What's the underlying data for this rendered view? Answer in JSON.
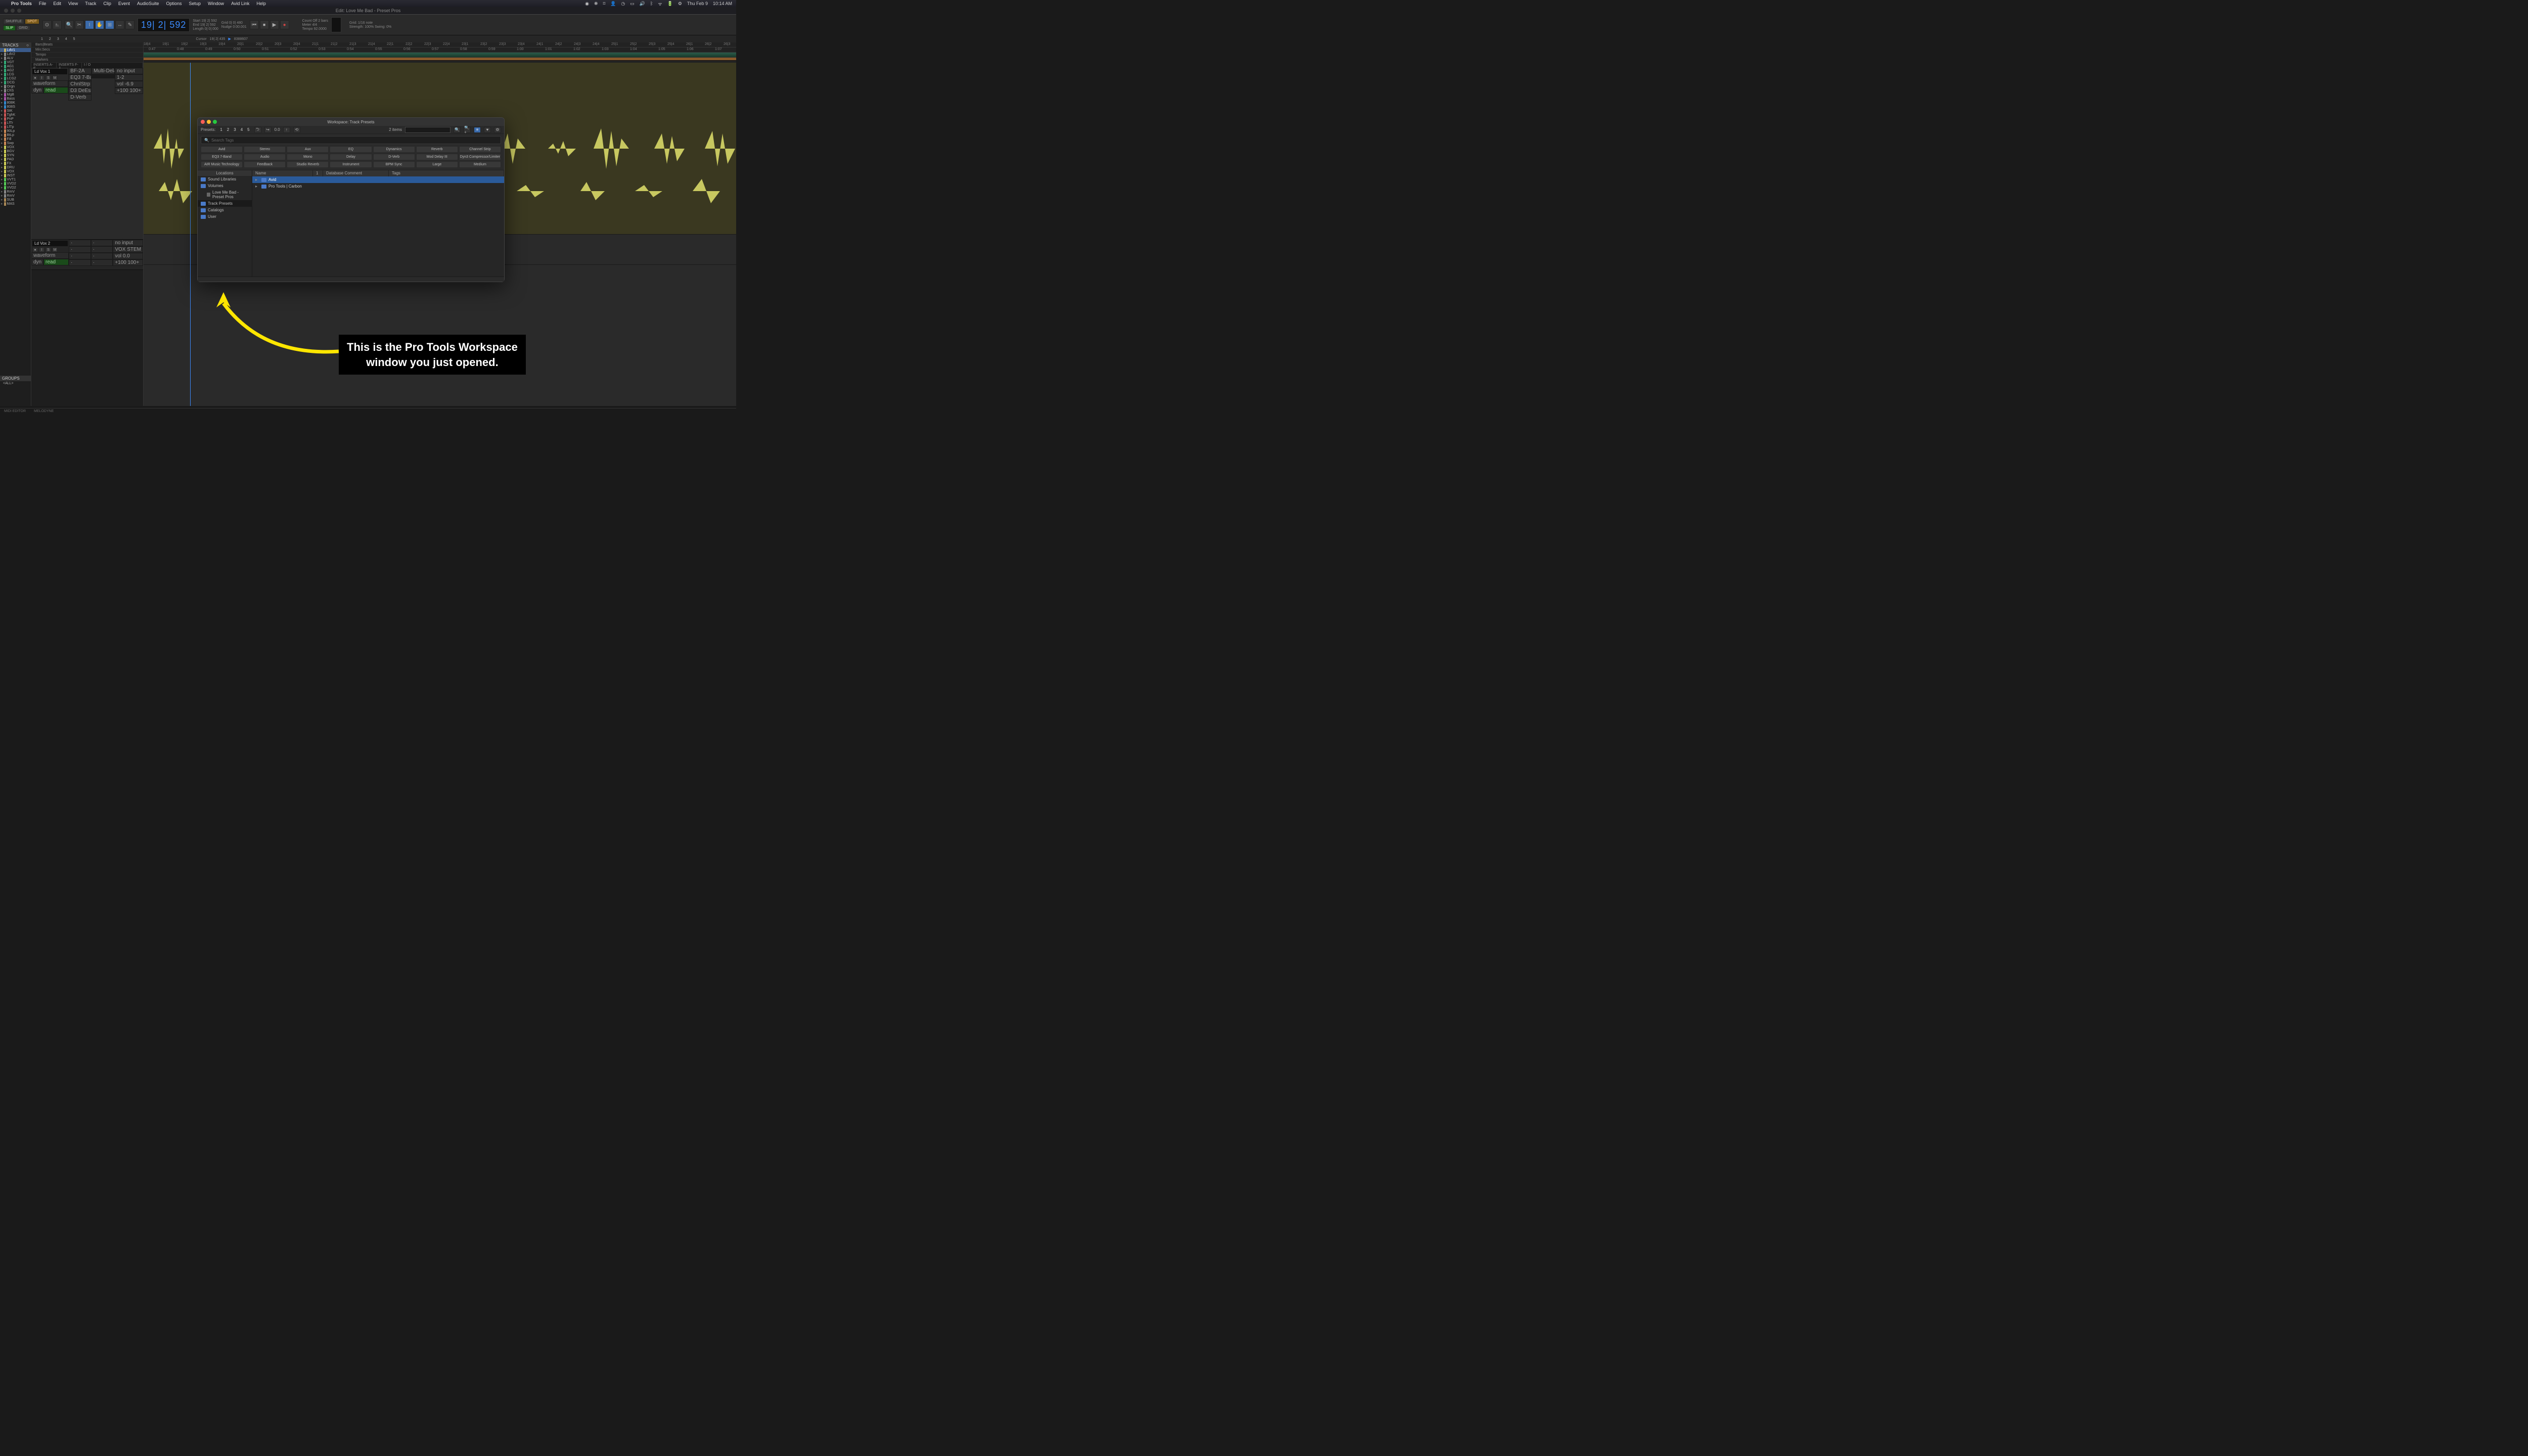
{
  "menubar": {
    "app": "Pro Tools",
    "items": [
      "File",
      "Edit",
      "View",
      "Track",
      "Clip",
      "Event",
      "AudioSuite",
      "Options",
      "Setup",
      "Window",
      "Avid Link",
      "Help"
    ],
    "right_date": "Thu Feb 9",
    "right_time": "10:14 AM"
  },
  "titlebar": {
    "title": "Edit: Love Me Bad - Preset Pros"
  },
  "toolbar": {
    "modes": {
      "shuffle": "SHUFFLE",
      "spot": "SPOT",
      "slip": "SLIP",
      "grid": "GRID"
    },
    "main_counter": "19| 2| 592",
    "start_label": "Start",
    "start_val": "19| 2| 592",
    "end_label": "End",
    "end_val": "19| 2| 592",
    "length_label": "Length",
    "length_val": "0| 0| 000",
    "grid_label": "Grid",
    "grid_val": "0| 0| 480",
    "nudge_label": "Nudge",
    "nudge_val": "0:00.001",
    "countoff": "Count Off",
    "countoff_val": "2 bars",
    "meter": "Meter",
    "meter_val": "4/4",
    "tempo": "Tempo",
    "tempo_val": "92.0000",
    "grid2": "Grid:",
    "grid2_val": "1/16 note",
    "strength": "Strength:",
    "strength_val": "100%",
    "swing": "Swing:",
    "swing_val": "0%",
    "cursor": "Cursor",
    "cursor_val": "19| 2| 435",
    "cursor_val2": "8388607"
  },
  "tracks_panel": {
    "header": "TRACKS",
    "groups_header": "GROUPS",
    "group_all": "<ALL>",
    "items": [
      {
        "c": "#c8b060",
        "n": "LdV1",
        "sel": true
      },
      {
        "c": "#888",
        "n": "LdV2"
      },
      {
        "c": "#888",
        "n": "ALV"
      },
      {
        "c": "#3a7",
        "n": "VGT"
      },
      {
        "c": "#3a7",
        "n": "AG1"
      },
      {
        "c": "#3a7",
        "n": "AG2"
      },
      {
        "c": "#3a7",
        "n": "LCG"
      },
      {
        "c": "#3a7",
        "n": "LCG2"
      },
      {
        "c": "#3a7",
        "n": "DCG"
      },
      {
        "c": "#888",
        "n": "Orgn"
      },
      {
        "c": "#888",
        "n": "ChS"
      },
      {
        "c": "#a5a",
        "n": "MgB"
      },
      {
        "c": "#a5a",
        "n": "Bass"
      },
      {
        "c": "#38c",
        "n": "808K"
      },
      {
        "c": "#38c",
        "n": "808S"
      },
      {
        "c": "#c55",
        "n": "StK"
      },
      {
        "c": "#c55",
        "n": "TghK"
      },
      {
        "c": "#c55",
        "n": "PnP"
      },
      {
        "c": "#c55",
        "n": "LfTr"
      },
      {
        "c": "#c55",
        "n": "LfTp"
      },
      {
        "c": "#c85",
        "n": "90Lp"
      },
      {
        "c": "#c85",
        "n": "BtLp"
      },
      {
        "c": "#c85",
        "n": "Fill"
      },
      {
        "c": "#c85",
        "n": "Swp"
      },
      {
        "c": "#cc5",
        "n": "VOX"
      },
      {
        "c": "#cc5",
        "n": "BGV"
      },
      {
        "c": "#cc5",
        "n": "SYN"
      },
      {
        "c": "#cc5",
        "n": "PAD"
      },
      {
        "c": "#cc5",
        "n": "FX"
      },
      {
        "c": "#cc5",
        "n": "DRU"
      },
      {
        "c": "#cc5",
        "n": "VOX"
      },
      {
        "c": "#cc5",
        "n": "INST"
      },
      {
        "c": "#5c5",
        "n": "VVT1"
      },
      {
        "c": "#5c5",
        "n": "VVD2"
      },
      {
        "c": "#5c5",
        "n": "VVD2"
      },
      {
        "c": "#888",
        "n": "RmV"
      },
      {
        "c": "#888",
        "n": "RmV"
      },
      {
        "c": "#a85",
        "n": "SUB"
      },
      {
        "c": "#a85",
        "n": "MAS"
      }
    ]
  },
  "rulers": {
    "labels": [
      "Bars|Beats",
      "Min:Secs",
      "Tempo",
      "Markers"
    ],
    "bar_ticks": [
      "18|4",
      "19|1",
      "19|2",
      "19|3",
      "19|4",
      "20|1",
      "20|2",
      "20|3",
      "20|4",
      "21|1",
      "21|2",
      "21|3",
      "21|4",
      "22|1",
      "22|2",
      "22|3",
      "22|4",
      "23|1",
      "23|2",
      "23|3",
      "23|4",
      "24|1",
      "24|2",
      "24|3",
      "24|4",
      "25|1",
      "25|2",
      "25|3",
      "25|4",
      "26|1",
      "26|2",
      "26|3"
    ],
    "time_ticks": [
      "0:47",
      "0:48",
      "0:49",
      "0:50",
      "0:51",
      "0:52",
      "0:53",
      "0:54",
      "0:55",
      "0:56",
      "0:57",
      "0:58",
      "0:59",
      "1:00",
      "1:01",
      "1:02",
      "1:03",
      "1:04",
      "1:05",
      "1:06",
      "1:07"
    ]
  },
  "track_headers": {
    "inserts_hdr": [
      "INSERTS A-E",
      "INSERTS F-J",
      "I / O"
    ],
    "vox1": {
      "name": "Ld Vox 1",
      "inserts_a": [
        "BF-2A",
        "EQ3 7-Band",
        "ChnlStrp",
        "D3 DeEsser",
        "D-Verb"
      ],
      "inserts_f": [
        "Multi-Delay",
        "",
        "",
        "",
        ""
      ],
      "io": [
        "no input",
        "1-2",
        "vol   -6.9",
        "+100  100+"
      ],
      "view": "waveform",
      "dyn": "dyn",
      "read": "read"
    },
    "vox2": {
      "name": "Ld Vox 2",
      "io": [
        "no input",
        "VOX STEM",
        "vol   0.0",
        "+100  100+"
      ],
      "view": "waveform",
      "dyn": "dyn",
      "read": "read"
    }
  },
  "workspace": {
    "title": "Workspace: Track Presets",
    "presets_label": "Presets:",
    "preset_nums": [
      "1",
      "2",
      "3",
      "4",
      "5"
    ],
    "value": "0.0",
    "items_count": "2 items",
    "search_placeholder": "Search Tags",
    "tag_rows": [
      [
        "Avid",
        "Stereo",
        "Aux",
        "EQ",
        "Dynamics",
        "Reverb",
        "Channel Strip"
      ],
      [
        "EQ3 7-Band",
        "Audio",
        "Mono",
        "Delay",
        "D-Verb",
        "Mod Delay III",
        "Dyn3 Compressor/Limiter"
      ],
      [
        "AIR Music Technology",
        "Feedback",
        "Studio Reverb",
        "Instrument",
        "BPM Sync",
        "Large",
        "Medium"
      ]
    ],
    "locations_hdr": "Locations",
    "locations": [
      {
        "n": "Sound Libraries",
        "icon": true
      },
      {
        "n": "Volumes",
        "icon": true
      },
      {
        "n": "Love Me Bad - Preset Pros",
        "icon": false,
        "indent": true
      },
      {
        "n": "Track Presets",
        "icon": true,
        "sel": true
      },
      {
        "n": "Catalogs",
        "icon": true
      },
      {
        "n": "User",
        "icon": true
      }
    ],
    "cols": [
      "Name",
      "1",
      "Database Comment",
      "Tags"
    ],
    "rows": [
      {
        "n": "Avid",
        "sel": true
      },
      {
        "n": "Pro Tools | Carbon",
        "sel": false
      }
    ]
  },
  "annotation": {
    "text": "This is the Pro Tools Workspace\nwindow you just opened."
  },
  "footer": {
    "tab1": "MIDI EDITOR",
    "tab2": "MELODYNE"
  }
}
